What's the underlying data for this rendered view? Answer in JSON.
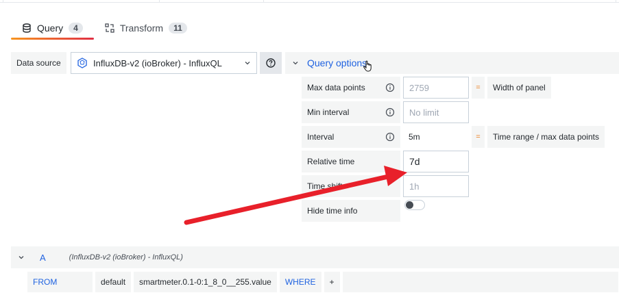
{
  "tabs": [
    {
      "label": "Query",
      "count": "4",
      "icon": "database-icon"
    },
    {
      "label": "Transform",
      "count": "11",
      "icon": "transform-icon"
    }
  ],
  "data_source": {
    "label": "Data source",
    "selected": "InfluxDB-v2 (ioBroker) - InfluxQL",
    "help_icon": "question-circle-icon"
  },
  "query_options": {
    "title": "Query options",
    "rows": [
      {
        "label": "Max data points",
        "value": "",
        "placeholder": "2759",
        "equals": "=",
        "description": "Width of panel"
      },
      {
        "label": "Min interval",
        "value": "",
        "placeholder": "No limit"
      },
      {
        "label": "Interval",
        "value": "5m",
        "equals": "=",
        "description": "Time range / max data points"
      },
      {
        "label": "Relative time",
        "value": "7d",
        "placeholder": ""
      },
      {
        "label": "Time shift",
        "value": "",
        "placeholder": "1h"
      },
      {
        "label": "Hide time info",
        "toggle": false
      }
    ]
  },
  "query_a": {
    "ref_id": "A",
    "datasource": "(InfluxDB-v2 (ioBroker) - InfluxQL)",
    "segments": [
      "FROM",
      "default",
      "smartmeter.0.1-0:1_8_0__255.value",
      "WHERE",
      "+"
    ]
  },
  "colors": {
    "accent_link": "#1f62e0",
    "tab_underline_start": "#f79520",
    "tab_underline_end": "#e02f44",
    "annotation_arrow": "#e8202a"
  }
}
